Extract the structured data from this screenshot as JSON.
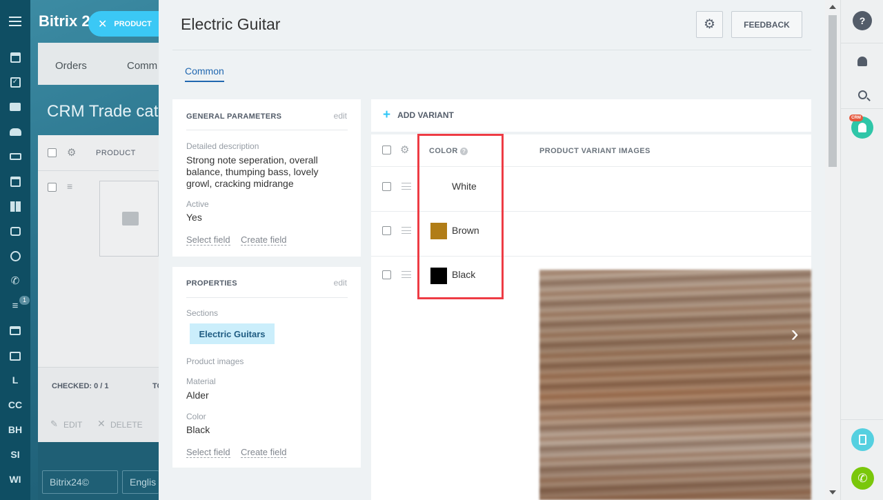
{
  "app": {
    "brand": "Bitrix 2",
    "product_pill": "PRODUCT"
  },
  "left_sidebar": {
    "text_items": [
      "L",
      "CC",
      "BH",
      "SI",
      "WI"
    ],
    "badge_count": "1"
  },
  "background_page": {
    "tabs": [
      "Orders",
      "Comm"
    ],
    "title": "CRM Trade cat",
    "grid_column": "PRODUCT",
    "checked": "CHECKED: 0 / 1",
    "total_prefix": "TO",
    "edit_label": "EDIT",
    "delete_label": "DELETE",
    "footer_brand": "Bitrix24©",
    "footer_lang": "Englis"
  },
  "slider": {
    "title": "Electric Guitar",
    "feedback_label": "FEEDBACK",
    "tab_label": "Common"
  },
  "general_params": {
    "title": "GENERAL PARAMETERS",
    "edit": "edit",
    "desc_label": "Detailed description",
    "desc_line1": "Strong note seperation, overall",
    "desc_line2": "balance, thumping bass, lovely",
    "desc_line3": "growl, cracking midrange",
    "active_label": "Active",
    "active_value": "Yes",
    "select_field": "Select field",
    "create_field": "Create field"
  },
  "properties": {
    "title": "PROPERTIES",
    "edit": "edit",
    "sections_label": "Sections",
    "section_value": "Electric Guitars",
    "images_label": "Product images",
    "material_label": "Material",
    "material_value": "Alder",
    "color_label": "Color",
    "color_value": "Black",
    "select_field": "Select field",
    "create_field": "Create field"
  },
  "variants": {
    "add_label": "ADD VARIANT",
    "col_color": "COLOR",
    "col_images": "PRODUCT VARIANT IMAGES",
    "rows": [
      {
        "name": "White",
        "swatch": "#ffffff"
      },
      {
        "name": "Brown",
        "swatch": "#b17d17"
      },
      {
        "name": "Black",
        "swatch": "#000000"
      }
    ]
  },
  "colors": {
    "accent": "#2067b0",
    "highlight_box": "#ee3b44",
    "chip_bg": "#cbeefb",
    "help_btn": "#535c69",
    "phone_btn": "#7ac70b",
    "transfer_btn": "#55d0e0",
    "avatar_bg": "#2fc6a8",
    "crm_badge": "#e65a3f"
  }
}
